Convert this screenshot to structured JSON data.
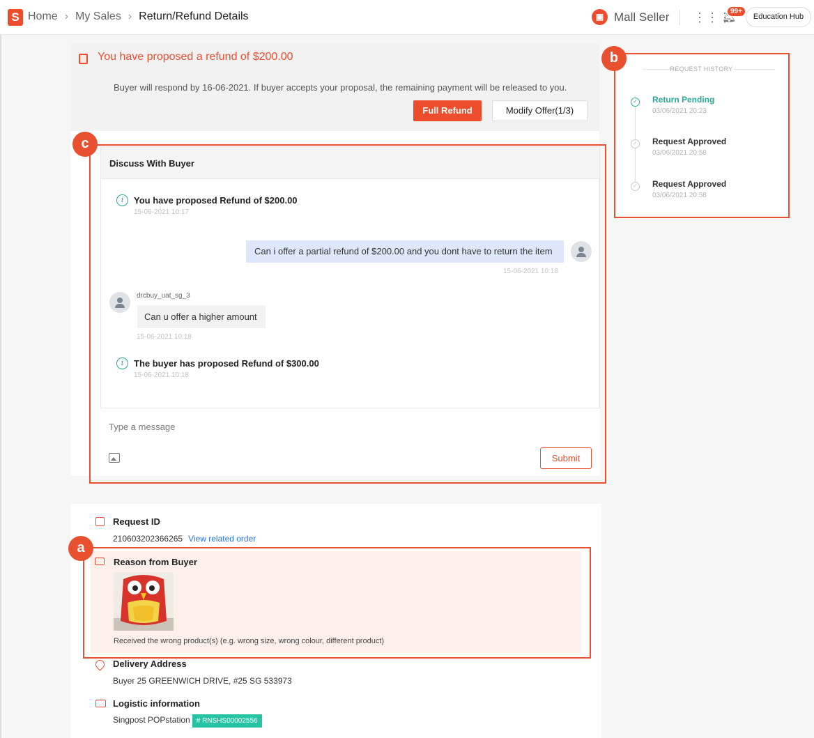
{
  "topbar": {
    "logo_text": "S",
    "breadcrumb": [
      "Home",
      "My Sales",
      "Return/Refund Details"
    ],
    "seller_label": "Mall Seller",
    "notification_badge": "99+",
    "education_hub": "Education Hub"
  },
  "proposal": {
    "title": "You have proposed a refund of $200.00",
    "description": "Buyer will respond by 16-06-2021. If buyer accepts your proposal, the remaining payment will be released to you.",
    "full_refund_label": "Full Refund",
    "modify_offer_label": "Modify Offer(1/3)"
  },
  "annotations": {
    "a": "a",
    "b": "b",
    "c": "c"
  },
  "chat": {
    "header": "Discuss With Buyer",
    "messages": [
      {
        "type": "system",
        "text": "You have proposed Refund of $200.00",
        "time": "15-06-2021 10:17"
      },
      {
        "type": "seller",
        "text": "Can i offer a partial refund of $200.00 and you dont have to return the item",
        "time": "15-06-2021 10:18"
      },
      {
        "type": "buyer",
        "sender": "drcbuy_uat_sg_3",
        "text": "Can u offer a higher amount",
        "time": "15-06-2021 10:18"
      },
      {
        "type": "system",
        "text": "The buyer has proposed Refund of $300.00",
        "time": "15-06-2021 10:18"
      }
    ],
    "input_placeholder": "Type a message",
    "submit_label": "Submit"
  },
  "history": {
    "title": "REQUEST HISTORY",
    "items": [
      {
        "status": "Return Pending",
        "time": "03/06/2021 20:23",
        "active": true
      },
      {
        "status": "Request Approved",
        "time": "03/06/2021 20:58",
        "active": false
      },
      {
        "status": "Request Approved",
        "time": "03/06/2021 20:58",
        "active": false
      }
    ]
  },
  "details": {
    "request_id_label": "Request ID",
    "request_id": "210603202366265",
    "view_order_link": "View related order",
    "reason_label": "Reason from Buyer",
    "reason_text": "Received the wrong product(s) (e.g. wrong size, wrong colour, different product)",
    "delivery_label": "Delivery Address",
    "delivery_address": "Buyer 25 GREENWICH DRIVE, #25 SG 533973",
    "logistic_label": "Logistic information",
    "logistic_provider": "Singpost POPstation",
    "tracking_number": "# RNSHS00002556"
  },
  "colors": {
    "brand": "#ee4d2d",
    "teal": "#26aa99",
    "annotation": "#e8502f",
    "seller_bubble": "#dfe8fb",
    "link": "#2673dd"
  }
}
